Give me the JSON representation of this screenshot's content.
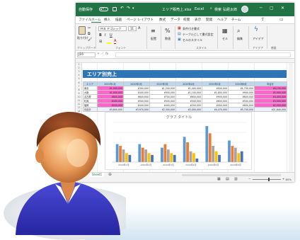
{
  "excel": {
    "titlebar": {
      "autosave": "自動保存",
      "autosave_state": "オフ",
      "filename": "エリア販売上.xlsx",
      "app": "Excel",
      "search": "検索",
      "user": "弘経太郎"
    },
    "menu": [
      "ファイル",
      "ホーム",
      "挿入",
      "描画",
      "ページ レイアウト",
      "数式",
      "データ",
      "校閲",
      "表示",
      "開発",
      "ヘルプ",
      "チーム"
    ],
    "active_menu": "ホーム",
    "ribbon": {
      "paste": "貼り付け",
      "font_name": "ＭＳ Ｐゴシック",
      "font_size": "11",
      "alignment": "配置",
      "number": "数値",
      "cond_format": "条件付き書式",
      "table_format": "テーブルとして書式設定",
      "cell_styles": "セルのスタイル",
      "cells": "セル",
      "editing": "編集",
      "ideas": "アイデア",
      "ideas_label": "アイデア",
      "groups": [
        "クリップボード",
        "フォント",
        "スタイル",
        "感度"
      ]
    },
    "formula_bar": {
      "name_box": "J16",
      "fx": "fx"
    },
    "rows": [
      "1",
      "2",
      "3",
      "4",
      "5",
      "6",
      "7",
      "8",
      "9",
      "10",
      "11",
      "12",
      "13",
      "14",
      "15",
      "16",
      "17",
      "18",
      "19",
      "20",
      "21",
      "22",
      "23",
      "24",
      "25",
      "26",
      "27",
      "28",
      "29",
      "30"
    ],
    "sheet_title": "エリア別売上",
    "table": {
      "headers": [
        "エリア",
        "2020年1月",
        "2020年2月",
        "2020年3月",
        "2020年4月",
        "2020年5月",
        "2020年6月",
        "年合計"
      ],
      "rows": [
        {
          "area": "東京",
          "values": [
            "¥1,000,000",
            "¥300,000",
            "¥1,200,000",
            "¥1,400,000",
            "¥500,000",
            "¥1,700,000",
            "¥6,100,000"
          ]
        },
        {
          "area": "大阪",
          "values": [
            "¥1,000,000",
            "¥400,000",
            "¥900,000",
            "¥1,100,000",
            "¥1,600,000",
            "¥900,000",
            "¥5,900,000"
          ]
        },
        {
          "area": "名古屋",
          "values": [
            "¥800,000",
            "¥600,000",
            "¥700,000",
            "¥600,000",
            "¥900,000",
            "¥800,000",
            "¥4,400,000"
          ]
        },
        {
          "area": "札幌",
          "values": [
            "¥400,000",
            "¥500,000",
            "¥500,000",
            "¥500,000",
            "¥600,000",
            "¥500,000",
            "¥3,000,000"
          ]
        },
        {
          "area": "福岡",
          "values": [
            "¥500,000",
            "¥400,000",
            "¥400,000",
            "¥200,000",
            "¥400,000",
            "¥600,000",
            "¥2,500,000"
          ]
        }
      ],
      "total": {
        "area": "月合計",
        "values": [
          "¥3,800,000",
          "¥3,970,000",
          "¥2,300,000",
          "¥2,000,000",
          "¥4,470,000",
          "¥5,700,000",
          "¥21,840,000"
        ]
      },
      "highlight_color": "#ff66cc"
    },
    "sheet_tab": "Sheet1",
    "status": {
      "zoom": "85%"
    }
  },
  "chart_data": {
    "type": "bar",
    "title": "グラフ タイトル",
    "categories": [
      "2020年1月",
      "2020年2月",
      "2020年3月",
      "2020年4月",
      "2020年5月",
      "2020年6月"
    ],
    "series": [
      {
        "values": [
          1000000,
          1000000,
          800000,
          1400000,
          2000000,
          1200000
        ],
        "color": "#5b9bd5"
      },
      {
        "values": [
          900000,
          800000,
          1000000,
          1100000,
          1600000,
          900000
        ],
        "color": "#ed7d31"
      },
      {
        "values": [
          700000,
          700000,
          700000,
          600000,
          900000,
          800000
        ],
        "color": "#a5a5a5"
      },
      {
        "values": [
          500000,
          500000,
          500000,
          500000,
          600000,
          500000
        ],
        "color": "#ffc000"
      },
      {
        "values": [
          400000,
          400000,
          400000,
          200000,
          400000,
          600000
        ],
        "color": "#4472c4"
      }
    ],
    "ylim": [
      0,
      2200000
    ],
    "grid": true
  },
  "colors": {
    "excel_green": "#217346",
    "title_blue": "#2e75b6",
    "header_blue": "#bdd7ee"
  },
  "person": {
    "skin": "#e29a5a",
    "shirt": "#3838c4",
    "collar": "#ffffff",
    "hair": "#7a3d1e"
  }
}
